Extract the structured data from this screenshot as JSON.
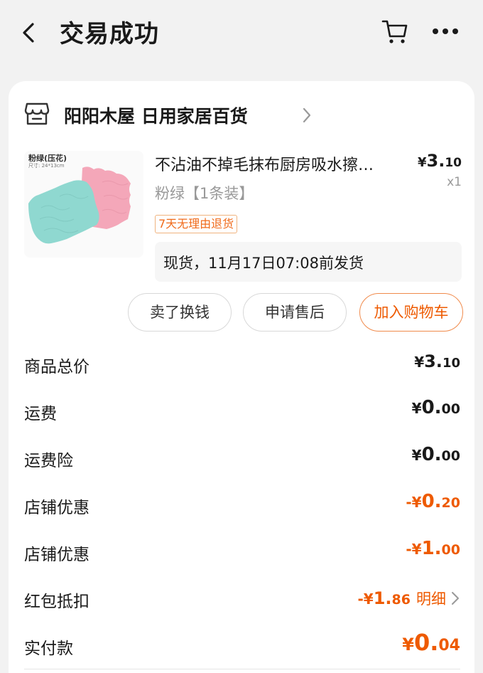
{
  "header": {
    "title": "交易成功",
    "back_icon": "chevron-left-icon",
    "cart_icon": "shopping-cart-icon",
    "more_icon": "more-dots-icon"
  },
  "shop": {
    "name": "阳阳木屋 日用家居百货",
    "icon": "store-icon"
  },
  "product": {
    "thumb_label": "粉绿(压花)",
    "thumb_size": "尺寸: 24*13cm",
    "title": "不沾油不掉毛抹布厨房吸水擦…",
    "price_currency": "¥",
    "price_int": "3.",
    "price_dec": "10",
    "quantity": "x1",
    "spec": "粉绿【1条装】",
    "return_badge": "7天无理由退货",
    "shipping": "现货，11月17日07:08前发货"
  },
  "actions": {
    "sell": "卖了换钱",
    "after_sale": "申请售后",
    "add_cart": "加入购物车"
  },
  "fees": {
    "total": {
      "label": "商品总价",
      "cur": "¥",
      "int": "3.",
      "dec": "10"
    },
    "shipping": {
      "label": "运费",
      "cur": "¥",
      "int": "0.",
      "dec": "00"
    },
    "insurance": {
      "label": "运费险",
      "cur": "¥",
      "int": "0.",
      "dec": "00"
    },
    "discount1": {
      "label": "店铺优惠",
      "cur": "-¥",
      "int": "0.",
      "dec": "20"
    },
    "discount2": {
      "label": "店铺优惠",
      "cur": "-¥",
      "int": "1.",
      "dec": "00"
    },
    "redpacket": {
      "label": "红包抵扣",
      "cur": "-¥",
      "int": "1.",
      "dec": "86",
      "detail": "明细"
    },
    "paid": {
      "label": "实付款",
      "cur": "¥",
      "int": "0.",
      "dec": "04"
    }
  },
  "colors": {
    "accent": "#ee5a00",
    "background": "#f2f2f2",
    "card": "#ffffff"
  }
}
